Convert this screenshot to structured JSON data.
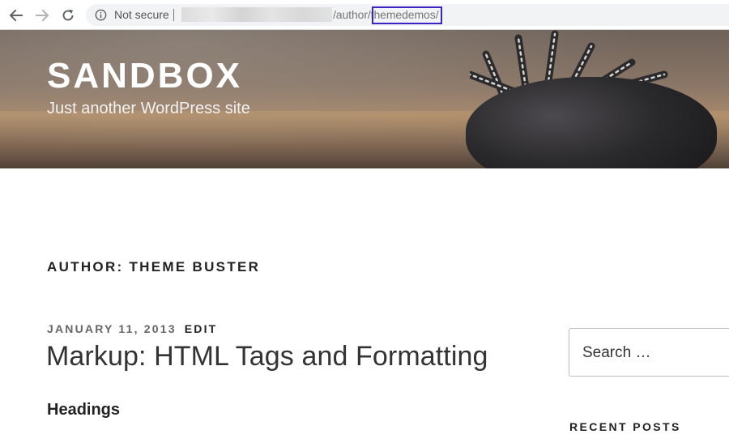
{
  "browser": {
    "security_label": "Not secure",
    "url_path": "/author/themedemos/",
    "highlighted_segment": "themedemos",
    "highlight_color": "#3a22c4"
  },
  "site": {
    "title": "SANDBOX",
    "tagline": "Just another WordPress site"
  },
  "page": {
    "archive_title": "AUTHOR: THEME BUSTER"
  },
  "post": {
    "date": "JANUARY 11, 2013",
    "edit_label": "EDIT",
    "title": "Markup: HTML Tags and Formatting",
    "first_heading": "Headings"
  },
  "sidebar": {
    "search_placeholder": "Search …",
    "widget_title": "RECENT POSTS"
  },
  "icons": {
    "back": "arrow-left-icon",
    "forward": "arrow-right-icon",
    "reload": "reload-icon",
    "info": "info-icon"
  }
}
